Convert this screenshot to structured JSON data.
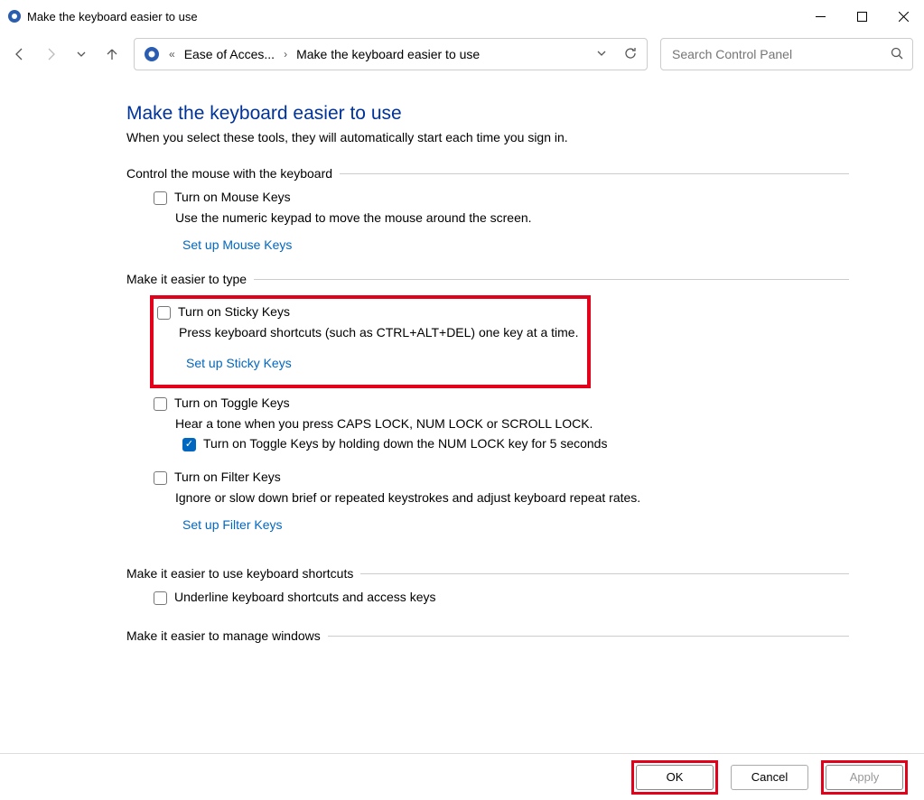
{
  "window": {
    "title": "Make the keyboard easier to use"
  },
  "breadcrumb": {
    "item1": "Ease of Acces...",
    "item2": "Make the keyboard easier to use"
  },
  "search": {
    "placeholder": "Search Control Panel"
  },
  "page": {
    "heading": "Make the keyboard easier to use",
    "subtitle": "When you select these tools, they will automatically start each time you sign in."
  },
  "section1": {
    "title": "Control the mouse with the keyboard",
    "mousekeys_label": "Turn on Mouse Keys",
    "mousekeys_desc": "Use the numeric keypad to move the mouse around the screen.",
    "mousekeys_link": "Set up Mouse Keys"
  },
  "section2": {
    "title": "Make it easier to type",
    "sticky_label": "Turn on Sticky Keys",
    "sticky_desc": "Press keyboard shortcuts (such as CTRL+ALT+DEL) one key at a time.",
    "sticky_link": "Set up Sticky Keys",
    "toggle_label": "Turn on Toggle Keys",
    "toggle_desc": "Hear a tone when you press CAPS LOCK, NUM LOCK or SCROLL LOCK.",
    "toggle_sub": "Turn on Toggle Keys by holding down the NUM LOCK key for 5 seconds",
    "filter_label": "Turn on Filter Keys",
    "filter_desc": "Ignore or slow down brief or repeated keystrokes and adjust keyboard repeat rates.",
    "filter_link": "Set up Filter Keys"
  },
  "section3": {
    "title": "Make it easier to use keyboard shortcuts",
    "underline_label": "Underline keyboard shortcuts and access keys"
  },
  "section4": {
    "title": "Make it easier to manage windows"
  },
  "footer": {
    "ok": "OK",
    "cancel": "Cancel",
    "apply": "Apply"
  }
}
